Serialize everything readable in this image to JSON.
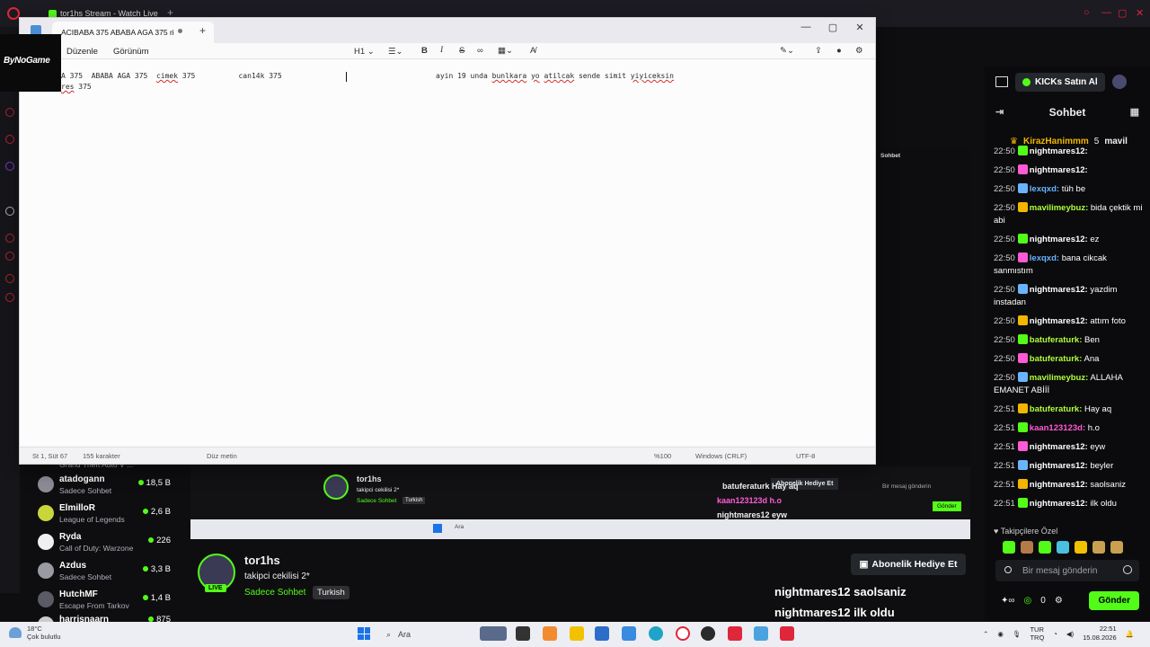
{
  "browser": {
    "tab_title": "tor1hs Stream - Watch Live"
  },
  "kick": {
    "buy_kicks_label": "KICKs Satın Al",
    "chat_title": "Sohbet",
    "pinned": {
      "user": "KirazHanimmm",
      "count": "5",
      "second_user": "mavil"
    },
    "messages": [
      {
        "time": "22:50",
        "user": "nightmares12:",
        "text": "",
        "color": "#ffffff"
      },
      {
        "time": "22:50",
        "user": "nightmares12:",
        "text": "",
        "color": "#ffffff"
      },
      {
        "time": "22:50",
        "user": "lexqxd:",
        "text": "tüh be",
        "color": "#6ab4ff"
      },
      {
        "time": "22:50",
        "user": "mavilimeybuz:",
        "text": "bida çektik mi abi",
        "color": "#b0ff3a"
      },
      {
        "time": "22:50",
        "user": "nightmares12:",
        "text": "ez",
        "color": "#ffffff"
      },
      {
        "time": "22:50",
        "user": "lexqxd:",
        "text": "bana cikcak sanmıstım",
        "color": "#6ab4ff"
      },
      {
        "time": "22:50",
        "user": "nightmares12:",
        "text": "yazdim instadan",
        "color": "#ffffff"
      },
      {
        "time": "22:50",
        "user": "nightmares12:",
        "text": "attım foto",
        "color": "#ffffff"
      },
      {
        "time": "22:50",
        "user": "batuferaturk:",
        "text": "Ben",
        "color": "#b0ff3a"
      },
      {
        "time": "22:50",
        "user": "batuferaturk:",
        "text": "Ana",
        "color": "#b0ff3a"
      },
      {
        "time": "22:50",
        "user": "mavilimeybuz:",
        "text": "ALLAHA EMANET ABİİİ",
        "color": "#b0ff3a"
      },
      {
        "time": "22:51",
        "user": "batuferaturk:",
        "text": "Hay aq",
        "color": "#b0ff3a"
      },
      {
        "time": "22:51",
        "user": "kaan123123d:",
        "text": "h.o",
        "color": "#ff5ad6"
      },
      {
        "time": "22:51",
        "user": "nightmares12:",
        "text": "eyw",
        "color": "#ffffff"
      },
      {
        "time": "22:51",
        "user": "nightmares12:",
        "text": "beyler",
        "color": "#ffffff"
      },
      {
        "time": "22:51",
        "user": "nightmares12:",
        "text": "saolsaniz",
        "color": "#ffffff"
      },
      {
        "time": "22:51",
        "user": "nightmares12:",
        "text": "ilk oldu",
        "color": "#ffffff"
      }
    ],
    "followers_label": "Takipçilere Özel",
    "input_placeholder": "Bir mesaj gönderin",
    "bottom_count": "0",
    "send_label": "Gönder"
  },
  "channels": [
    {
      "name": "",
      "game": "Grand Theft Auto V ...",
      "viewers": ""
    },
    {
      "name": "atadogann",
      "game": "Sadece Sohbet",
      "viewers": "18,5 B"
    },
    {
      "name": "ElmilloR",
      "game": "League of Legends",
      "viewers": "2,6 B"
    },
    {
      "name": "Ryda",
      "game": "Call of Duty: Warzone",
      "viewers": "226"
    },
    {
      "name": "Azdus",
      "game": "Sadece Sohbet",
      "viewers": "3,3 B"
    },
    {
      "name": "HutchMF",
      "game": "Escape From Tarkov",
      "viewers": "1,4 B"
    },
    {
      "name": "harrisnaarn",
      "game": "",
      "viewers": "875"
    }
  ],
  "stream": {
    "streamer": "tor1hs",
    "title": "takipci cekilisi 2*",
    "category": "Sadece Sohbet",
    "language": "Turkish",
    "live_label": "LIVE",
    "sub_gift_label": "Abonelik Hediye Et",
    "overlay_line1": "nightmares12 saolsaniz",
    "overlay_line2": "nightmares12 ilk oldu"
  },
  "mini": {
    "gift_label": "Abonelik Hediye Et",
    "overlay_a": "batuferaturk Hay aq",
    "overlay_b": "kaan123123d h.o",
    "overlay_c": "nightmares12 eyw",
    "input": "Bir mesaj gönderin",
    "send": "Gönder",
    "streamer": "tor1hs",
    "title": "takipci cekilisi 2*",
    "category": "Sadece Sohbet",
    "language": "Turkish"
  },
  "notepad": {
    "tab_title": "ACIBABA 375 ABABA AGA 375 ri",
    "menu": [
      "Düzenle",
      "Görünüm"
    ],
    "heading_btn": "H1",
    "line1_a": "A 375  ABABA AGA 375  ",
    "line1_word": "cimek",
    "line1_b": " 375          can14k 375",
    "line2_word": "res",
    "line2_b": " 375",
    "right_a": "ayin 19 unda ",
    "right_w1": "bunlkara",
    "right_sp": " ",
    "right_w2": "yo",
    "right_sp2": " ",
    "right_w3": "atilcak",
    "right_b": " sende simit ",
    "right_w4": "yiyiceksin",
    "status": {
      "position": "St 1, Süt 67",
      "chars": "155 karakter",
      "format": "Düz metin",
      "zoom": "%100",
      "eol": "Windows (CRLF)",
      "encoding": "UTF-8"
    }
  },
  "overlay_brand": "ByNoGame",
  "taskbar": {
    "temp": "18°C",
    "weather": "Çok bulutlu",
    "search": "Ara",
    "lang1": "TUR",
    "lang2": "TRQ",
    "time": "22:51",
    "date": "15.08.2026"
  }
}
